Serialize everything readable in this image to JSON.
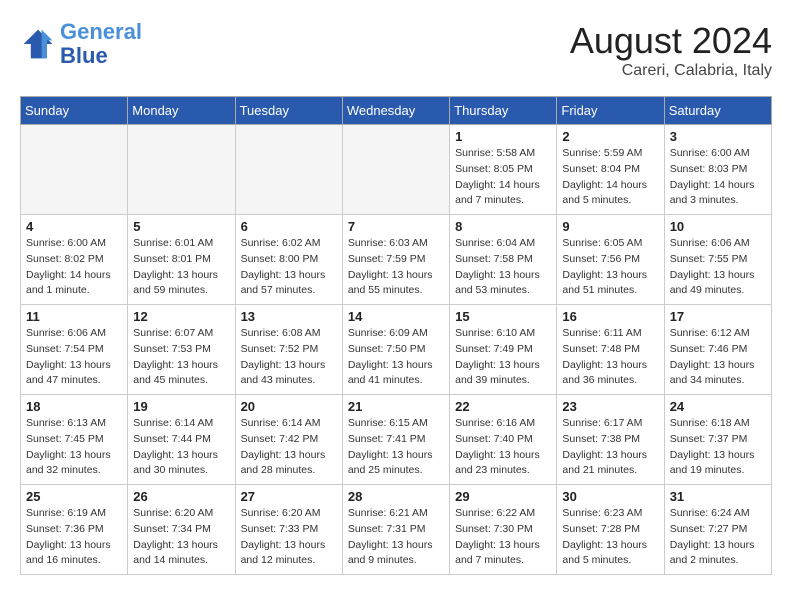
{
  "header": {
    "logo_line1": "General",
    "logo_line2": "Blue",
    "month": "August 2024",
    "location": "Careri, Calabria, Italy"
  },
  "days_of_week": [
    "Sunday",
    "Monday",
    "Tuesday",
    "Wednesday",
    "Thursday",
    "Friday",
    "Saturday"
  ],
  "weeks": [
    [
      {
        "day": "",
        "info": ""
      },
      {
        "day": "",
        "info": ""
      },
      {
        "day": "",
        "info": ""
      },
      {
        "day": "",
        "info": ""
      },
      {
        "day": "1",
        "info": "Sunrise: 5:58 AM\nSunset: 8:05 PM\nDaylight: 14 hours and 7 minutes."
      },
      {
        "day": "2",
        "info": "Sunrise: 5:59 AM\nSunset: 8:04 PM\nDaylight: 14 hours and 5 minutes."
      },
      {
        "day": "3",
        "info": "Sunrise: 6:00 AM\nSunset: 8:03 PM\nDaylight: 14 hours and 3 minutes."
      }
    ],
    [
      {
        "day": "4",
        "info": "Sunrise: 6:00 AM\nSunset: 8:02 PM\nDaylight: 14 hours and 1 minute."
      },
      {
        "day": "5",
        "info": "Sunrise: 6:01 AM\nSunset: 8:01 PM\nDaylight: 13 hours and 59 minutes."
      },
      {
        "day": "6",
        "info": "Sunrise: 6:02 AM\nSunset: 8:00 PM\nDaylight: 13 hours and 57 minutes."
      },
      {
        "day": "7",
        "info": "Sunrise: 6:03 AM\nSunset: 7:59 PM\nDaylight: 13 hours and 55 minutes."
      },
      {
        "day": "8",
        "info": "Sunrise: 6:04 AM\nSunset: 7:58 PM\nDaylight: 13 hours and 53 minutes."
      },
      {
        "day": "9",
        "info": "Sunrise: 6:05 AM\nSunset: 7:56 PM\nDaylight: 13 hours and 51 minutes."
      },
      {
        "day": "10",
        "info": "Sunrise: 6:06 AM\nSunset: 7:55 PM\nDaylight: 13 hours and 49 minutes."
      }
    ],
    [
      {
        "day": "11",
        "info": "Sunrise: 6:06 AM\nSunset: 7:54 PM\nDaylight: 13 hours and 47 minutes."
      },
      {
        "day": "12",
        "info": "Sunrise: 6:07 AM\nSunset: 7:53 PM\nDaylight: 13 hours and 45 minutes."
      },
      {
        "day": "13",
        "info": "Sunrise: 6:08 AM\nSunset: 7:52 PM\nDaylight: 13 hours and 43 minutes."
      },
      {
        "day": "14",
        "info": "Sunrise: 6:09 AM\nSunset: 7:50 PM\nDaylight: 13 hours and 41 minutes."
      },
      {
        "day": "15",
        "info": "Sunrise: 6:10 AM\nSunset: 7:49 PM\nDaylight: 13 hours and 39 minutes."
      },
      {
        "day": "16",
        "info": "Sunrise: 6:11 AM\nSunset: 7:48 PM\nDaylight: 13 hours and 36 minutes."
      },
      {
        "day": "17",
        "info": "Sunrise: 6:12 AM\nSunset: 7:46 PM\nDaylight: 13 hours and 34 minutes."
      }
    ],
    [
      {
        "day": "18",
        "info": "Sunrise: 6:13 AM\nSunset: 7:45 PM\nDaylight: 13 hours and 32 minutes."
      },
      {
        "day": "19",
        "info": "Sunrise: 6:14 AM\nSunset: 7:44 PM\nDaylight: 13 hours and 30 minutes."
      },
      {
        "day": "20",
        "info": "Sunrise: 6:14 AM\nSunset: 7:42 PM\nDaylight: 13 hours and 28 minutes."
      },
      {
        "day": "21",
        "info": "Sunrise: 6:15 AM\nSunset: 7:41 PM\nDaylight: 13 hours and 25 minutes."
      },
      {
        "day": "22",
        "info": "Sunrise: 6:16 AM\nSunset: 7:40 PM\nDaylight: 13 hours and 23 minutes."
      },
      {
        "day": "23",
        "info": "Sunrise: 6:17 AM\nSunset: 7:38 PM\nDaylight: 13 hours and 21 minutes."
      },
      {
        "day": "24",
        "info": "Sunrise: 6:18 AM\nSunset: 7:37 PM\nDaylight: 13 hours and 19 minutes."
      }
    ],
    [
      {
        "day": "25",
        "info": "Sunrise: 6:19 AM\nSunset: 7:36 PM\nDaylight: 13 hours and 16 minutes."
      },
      {
        "day": "26",
        "info": "Sunrise: 6:20 AM\nSunset: 7:34 PM\nDaylight: 13 hours and 14 minutes."
      },
      {
        "day": "27",
        "info": "Sunrise: 6:20 AM\nSunset: 7:33 PM\nDaylight: 13 hours and 12 minutes."
      },
      {
        "day": "28",
        "info": "Sunrise: 6:21 AM\nSunset: 7:31 PM\nDaylight: 13 hours and 9 minutes."
      },
      {
        "day": "29",
        "info": "Sunrise: 6:22 AM\nSunset: 7:30 PM\nDaylight: 13 hours and 7 minutes."
      },
      {
        "day": "30",
        "info": "Sunrise: 6:23 AM\nSunset: 7:28 PM\nDaylight: 13 hours and 5 minutes."
      },
      {
        "day": "31",
        "info": "Sunrise: 6:24 AM\nSunset: 7:27 PM\nDaylight: 13 hours and 2 minutes."
      }
    ]
  ]
}
